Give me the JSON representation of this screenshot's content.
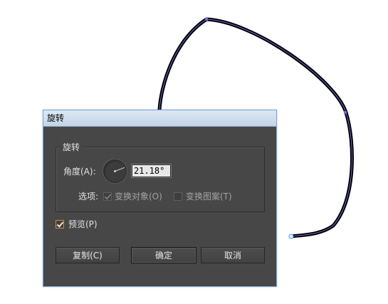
{
  "dialog": {
    "title": "旋转",
    "group_label": "旋转",
    "angle_label": "角度(A):",
    "angle_value": "21.18°",
    "options_label": "选项:",
    "transform_objects_label": "变换对象(O)",
    "transform_objects_checked": true,
    "transform_patterns_label": "变换图案(T)",
    "transform_patterns_checked": false,
    "preview_label": "预览(P)",
    "preview_checked": true,
    "copy_button": "复制(C)",
    "ok_button": "确定",
    "cancel_button": "取消"
  },
  "colors": {
    "dialog_bg": "#474747",
    "titlebar": "#c9d9ec",
    "accent": "#d88a2f",
    "path_stroke": "#000000",
    "path_highlight": "#5a5ad0"
  }
}
